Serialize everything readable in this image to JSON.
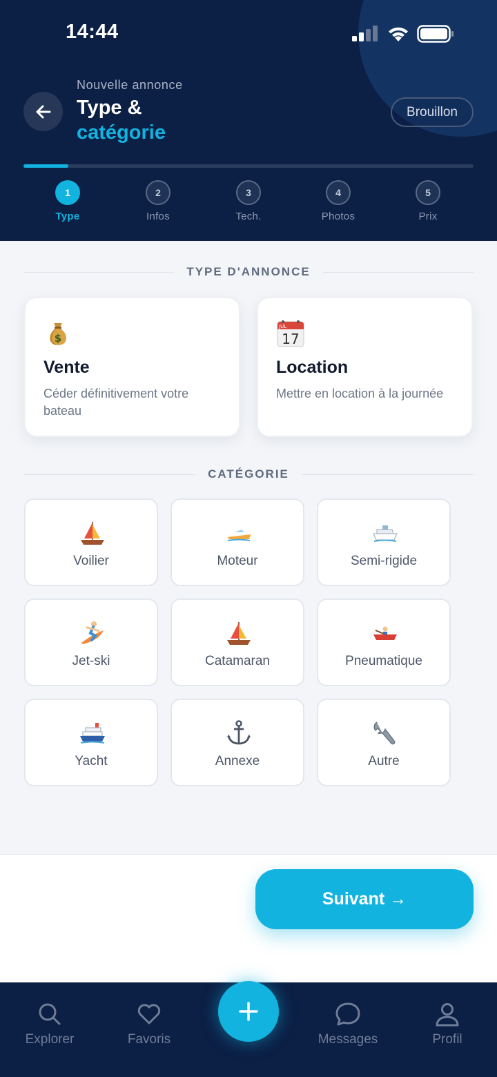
{
  "status_bar": {
    "time": "14:44"
  },
  "header": {
    "subtitle": "Nouvelle annonce",
    "title_line1": "Type &",
    "title_line2": "catégorie",
    "draft_button": "Brouillon",
    "progress": 0.1
  },
  "steps": [
    {
      "number": "1",
      "label": "Type",
      "active": true
    },
    {
      "number": "2",
      "label": "Infos",
      "active": false
    },
    {
      "number": "3",
      "label": "Tech.",
      "active": false
    },
    {
      "number": "4",
      "label": "Photos",
      "active": false
    },
    {
      "number": "5",
      "label": "Prix",
      "active": false
    }
  ],
  "listing_type": {
    "heading": "TYPE D'ANNONCE",
    "options": [
      {
        "icon": "money-bag-icon",
        "title": "Vente",
        "description": "Céder définitivement votre bateau"
      },
      {
        "icon": "calendar-icon",
        "calendar_month": "JUL",
        "calendar_day": "17",
        "title": "Location",
        "description": "Mettre en location à la journée"
      }
    ]
  },
  "category": {
    "heading": "CATÉGORIE",
    "items": [
      {
        "icon": "sailboat-icon",
        "label": "Voilier"
      },
      {
        "icon": "speedboat-icon",
        "label": "Moteur"
      },
      {
        "icon": "passenger-ship-icon",
        "label": "Semi-rigide"
      },
      {
        "icon": "surfer-icon",
        "label": "Jet-ski"
      },
      {
        "icon": "sailboat-icon",
        "label": "Catamaran"
      },
      {
        "icon": "rowboat-icon",
        "label": "Pneumatique"
      },
      {
        "icon": "ship-icon",
        "label": "Yacht"
      },
      {
        "icon": "anchor-icon",
        "label": "Annexe"
      },
      {
        "icon": "wrench-icon",
        "label": "Autre"
      }
    ]
  },
  "action": {
    "next_label": "Suivant →"
  },
  "bottom_nav": {
    "items": [
      {
        "icon": "search-icon",
        "label": "Explorer"
      },
      {
        "icon": "heart-icon",
        "label": "Favoris"
      },
      {
        "icon": "plus-icon",
        "label": ""
      },
      {
        "icon": "chat-bubble-icon",
        "label": "Messages"
      },
      {
        "icon": "user-icon",
        "label": "Profil"
      }
    ]
  },
  "colors": {
    "primary": "#12b3de",
    "header_bg": "#0c1f45",
    "page_bg": "#f3f5f8"
  }
}
